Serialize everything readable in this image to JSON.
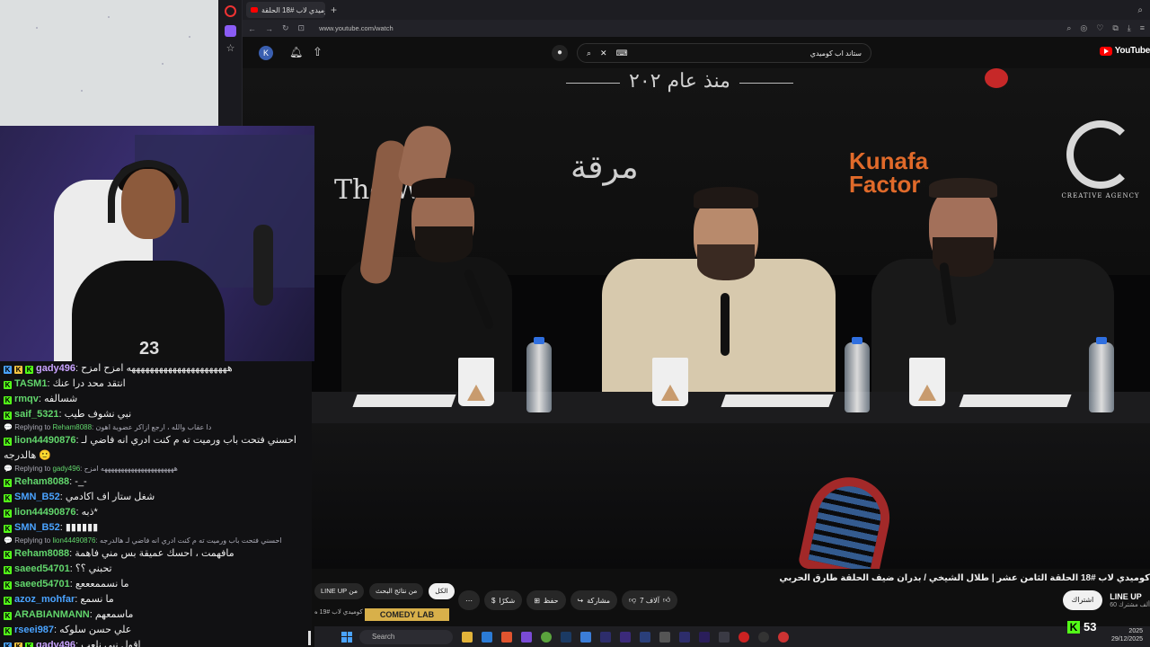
{
  "browser": {
    "tab_title": "كوميدي لاب #18 الحلقة...",
    "url": "www.youtube.com/watch"
  },
  "youtube": {
    "avatar_letter": "K",
    "search_value": "ستاند اب كوميدي",
    "logo_text": "YouTube",
    "video_title": "كوميدي لاب #18 الحلقة الثامن عشر | طلال الشيخي / بدران ضيف الحلقة طارق الحربي",
    "chips": [
      "الكل",
      "من نتائج البحث",
      "من LINE UP"
    ],
    "selected_chip": "الكل",
    "actions": {
      "like": "7 آلاف",
      "share": "مشاركة",
      "save": "حفظ",
      "thanks": "شكرًا",
      "more": "⋯"
    },
    "subscribe_label": "اشتراك",
    "channel_name": "LINE UP",
    "channel_subs": "60 ألف مشترك",
    "rec_thumb_label": "كوميدي لاب #19 ه",
    "rec_thumb_image_text": "COMEDY LAB"
  },
  "stage": {
    "banner_top": "منذ عام ٢٠٢",
    "sponsor_1": "The W...e",
    "sponsor_2": "مرقة",
    "sponsor_3_line1": "Kunafa",
    "sponsor_3_line2": "Factor",
    "sponsor_4": "CREATIVE AGENCY"
  },
  "webcam": {
    "jersey_number": "23"
  },
  "chat": {
    "messages": [
      {
        "type": "msg",
        "user": "gady496",
        "color": "#c9a3ff",
        "text": "ههههههههههههههههههههههه امزح امزح",
        "badges": 3
      },
      {
        "type": "msg",
        "user": "TASM1",
        "color": "#62d66c",
        "text": "انتقد محد درا عنك"
      },
      {
        "type": "msg",
        "user": "rmqv",
        "color": "#62d66c",
        "text": "شسالفه"
      },
      {
        "type": "msg",
        "user": "saif_5321",
        "color": "#62d66c",
        "text": "نبي نشوف طيب"
      },
      {
        "type": "reply",
        "to": "Reham8088",
        "text": "دا عقاب والله ، ارجع ازاكر عضوية اهون"
      },
      {
        "type": "msg",
        "user": "lion44490876",
        "color": "#62d66c",
        "text": "احسني فتحت باب ورميت ته م كنت ادري انه فاضي لـ"
      },
      {
        "type": "cont",
        "text": "هالدرجه 🙂"
      },
      {
        "type": "reply",
        "to": "gady496",
        "text": "ههههههههههههههههههههههه امزح"
      },
      {
        "type": "msg",
        "user": "Reham8088",
        "color": "#62d66c",
        "text": "-_-"
      },
      {
        "type": "msg",
        "user": "SMN_B52",
        "color": "#4aa3ff",
        "text": "شغل ستار اف اكادمي"
      },
      {
        "type": "msg",
        "user": "lion44490876",
        "color": "#62d66c",
        "text": "ذبه*"
      },
      {
        "type": "msg",
        "user": "SMN_B52",
        "color": "#4aa3ff",
        "text": "▮▮▮▮▮▮"
      },
      {
        "type": "reply",
        "to": "lion44490876",
        "text": "احسني فتحت باب ورميت ته م كنت ادري انه فاضي لـ هالدرجه"
      },
      {
        "type": "msg",
        "user": "Reham8088",
        "color": "#62d66c",
        "text": "مافهمت ، احسك عميقة بس مني فاهمة"
      },
      {
        "type": "msg",
        "user": "saeed54701",
        "color": "#62d66c",
        "text": "تحبني ؟؟"
      },
      {
        "type": "msg",
        "user": "saeed54701",
        "color": "#62d66c",
        "text": "ما نسممعععع"
      },
      {
        "type": "msg",
        "user": "azoz_mohfar",
        "color": "#4aa3ff",
        "text": "ما نسمع"
      },
      {
        "type": "msg",
        "user": "ARABIANMANN",
        "color": "#62d66c",
        "text": "ماسمعهم"
      },
      {
        "type": "msg",
        "user": "rseei987",
        "color": "#4aa3ff",
        "text": "علي حسن سلوكه"
      },
      {
        "type": "msg",
        "user": "gady496",
        "color": "#c9a3ff",
        "text": "اقول نبي نلعب",
        "badges": 3
      }
    ],
    "reply_prefix": "Replying to"
  },
  "taskbar": {
    "search_placeholder": "Search",
    "kick_viewers": "53",
    "clock_year": "2025",
    "clock_date": "29/12/2025"
  }
}
